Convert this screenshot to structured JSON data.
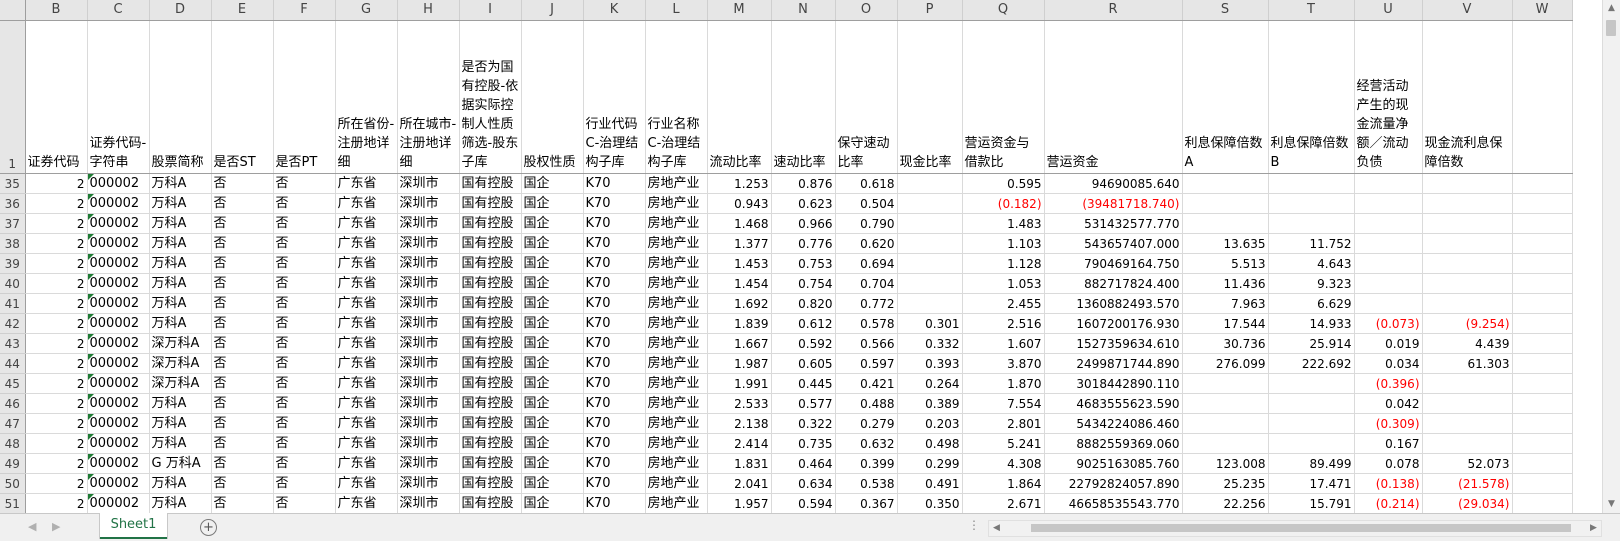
{
  "app": "Microsoft Excel",
  "columns": [
    "B",
    "C",
    "D",
    "E",
    "F",
    "G",
    "H",
    "I",
    "J",
    "K",
    "L",
    "M",
    "N",
    "O",
    "P",
    "Q",
    "R",
    "S",
    "T",
    "U",
    "V",
    "W"
  ],
  "header_row_number": "1",
  "headers": [
    "证券代码",
    "证券代码-字符串",
    "股票简称",
    "是否ST",
    "是否PT",
    "所在省份-注册地详细",
    "所在城市-注册地详细",
    "是否为国有控股-依据实际控制人性质筛选-股东子库",
    "股权性质",
    "行业代码C-治理结构子库",
    "行业名称C-治理结构子库",
    "流动比率",
    "速动比率",
    "保守速动比率",
    "现金比率",
    "营运资金与借款比",
    "营运资金",
    "利息保障倍数A",
    "利息保障倍数B",
    "经营活动产生的现金流量净额／流动负债",
    "现金流利息保障倍数",
    ""
  ],
  "rows": [
    {
      "n": "35",
      "v": [
        "2",
        "000002",
        "万科A",
        "否",
        "否",
        "广东省",
        "深圳市",
        "国有控股",
        "国企",
        "K70",
        "房地产业",
        "1.253",
        "0.876",
        "0.618",
        "",
        "0.595",
        "94690085.640",
        "",
        "",
        "",
        "",
        ""
      ]
    },
    {
      "n": "36",
      "v": [
        "2",
        "000002",
        "万科A",
        "否",
        "否",
        "广东省",
        "深圳市",
        "国有控股",
        "国企",
        "K70",
        "房地产业",
        "0.943",
        "0.623",
        "0.504",
        "",
        "(0.182)",
        "(39481718.740)",
        "",
        "",
        "",
        "",
        ""
      ]
    },
    {
      "n": "37",
      "v": [
        "2",
        "000002",
        "万科A",
        "否",
        "否",
        "广东省",
        "深圳市",
        "国有控股",
        "国企",
        "K70",
        "房地产业",
        "1.468",
        "0.966",
        "0.790",
        "",
        "1.483",
        "531432577.770",
        "",
        "",
        "",
        "",
        ""
      ]
    },
    {
      "n": "38",
      "v": [
        "2",
        "000002",
        "万科A",
        "否",
        "否",
        "广东省",
        "深圳市",
        "国有控股",
        "国企",
        "K70",
        "房地产业",
        "1.377",
        "0.776",
        "0.620",
        "",
        "1.103",
        "543657407.000",
        "13.635",
        "11.752",
        "",
        "",
        ""
      ]
    },
    {
      "n": "39",
      "v": [
        "2",
        "000002",
        "万科A",
        "否",
        "否",
        "广东省",
        "深圳市",
        "国有控股",
        "国企",
        "K70",
        "房地产业",
        "1.453",
        "0.753",
        "0.694",
        "",
        "1.128",
        "790469164.750",
        "5.513",
        "4.643",
        "",
        "",
        ""
      ]
    },
    {
      "n": "40",
      "v": [
        "2",
        "000002",
        "万科A",
        "否",
        "否",
        "广东省",
        "深圳市",
        "国有控股",
        "国企",
        "K70",
        "房地产业",
        "1.454",
        "0.754",
        "0.704",
        "",
        "1.053",
        "882717824.400",
        "11.436",
        "9.323",
        "",
        "",
        ""
      ]
    },
    {
      "n": "41",
      "v": [
        "2",
        "000002",
        "万科A",
        "否",
        "否",
        "广东省",
        "深圳市",
        "国有控股",
        "国企",
        "K70",
        "房地产业",
        "1.692",
        "0.820",
        "0.772",
        "",
        "2.455",
        "1360882493.570",
        "7.963",
        "6.629",
        "",
        "",
        ""
      ]
    },
    {
      "n": "42",
      "v": [
        "2",
        "000002",
        "万科A",
        "否",
        "否",
        "广东省",
        "深圳市",
        "国有控股",
        "国企",
        "K70",
        "房地产业",
        "1.839",
        "0.612",
        "0.578",
        "0.301",
        "2.516",
        "1607200176.930",
        "17.544",
        "14.933",
        "(0.073)",
        "(9.254)",
        ""
      ]
    },
    {
      "n": "43",
      "v": [
        "2",
        "000002",
        "深万科A",
        "否",
        "否",
        "广东省",
        "深圳市",
        "国有控股",
        "国企",
        "K70",
        "房地产业",
        "1.667",
        "0.592",
        "0.566",
        "0.332",
        "1.607",
        "1527359634.610",
        "30.736",
        "25.914",
        "0.019",
        "4.439",
        ""
      ]
    },
    {
      "n": "44",
      "v": [
        "2",
        "000002",
        "深万科A",
        "否",
        "否",
        "广东省",
        "深圳市",
        "国有控股",
        "国企",
        "K70",
        "房地产业",
        "1.987",
        "0.605",
        "0.597",
        "0.393",
        "3.870",
        "2499871744.890",
        "276.099",
        "222.692",
        "0.034",
        "61.303",
        ""
      ]
    },
    {
      "n": "45",
      "v": [
        "2",
        "000002",
        "深万科A",
        "否",
        "否",
        "广东省",
        "深圳市",
        "国有控股",
        "国企",
        "K70",
        "房地产业",
        "1.991",
        "0.445",
        "0.421",
        "0.264",
        "1.870",
        "3018442890.110",
        "",
        "",
        "(0.396)",
        "",
        ""
      ]
    },
    {
      "n": "46",
      "v": [
        "2",
        "000002",
        "万科A",
        "否",
        "否",
        "广东省",
        "深圳市",
        "国有控股",
        "国企",
        "K70",
        "房地产业",
        "2.533",
        "0.577",
        "0.488",
        "0.389",
        "7.554",
        "4683555623.590",
        "",
        "",
        "0.042",
        "",
        ""
      ]
    },
    {
      "n": "47",
      "v": [
        "2",
        "000002",
        "万科A",
        "否",
        "否",
        "广东省",
        "深圳市",
        "国有控股",
        "国企",
        "K70",
        "房地产业",
        "2.138",
        "0.322",
        "0.279",
        "0.203",
        "2.801",
        "5434224086.460",
        "",
        "",
        "(0.309)",
        "",
        ""
      ]
    },
    {
      "n": "48",
      "v": [
        "2",
        "000002",
        "万科A",
        "否",
        "否",
        "广东省",
        "深圳市",
        "国有控股",
        "国企",
        "K70",
        "房地产业",
        "2.414",
        "0.735",
        "0.632",
        "0.498",
        "5.241",
        "8882559369.060",
        "",
        "",
        "0.167",
        "",
        ""
      ]
    },
    {
      "n": "49",
      "v": [
        "2",
        "000002",
        "G 万科A",
        "否",
        "否",
        "广东省",
        "深圳市",
        "国有控股",
        "国企",
        "K70",
        "房地产业",
        "1.831",
        "0.464",
        "0.399",
        "0.299",
        "4.308",
        "9025163085.760",
        "123.008",
        "89.499",
        "0.078",
        "52.073",
        ""
      ]
    },
    {
      "n": "50",
      "v": [
        "2",
        "000002",
        "万科A",
        "否",
        "否",
        "广东省",
        "深圳市",
        "国有控股",
        "国企",
        "K70",
        "房地产业",
        "2.041",
        "0.634",
        "0.538",
        "0.491",
        "1.864",
        "22792824057.890",
        "25.235",
        "17.471",
        "(0.138)",
        "(21.578)",
        ""
      ]
    },
    {
      "n": "51",
      "v": [
        "2",
        "000002",
        "万科A",
        "否",
        "否",
        "广东省",
        "深圳市",
        "国有控股",
        "国企",
        "K70",
        "房地产业",
        "1.957",
        "0.594",
        "0.367",
        "0.350",
        "2.671",
        "46658535543.770",
        "22.256",
        "15.791",
        "(0.214)",
        "(29.034)",
        ""
      ]
    }
  ],
  "sheet_tab": "Sheet1",
  "colors": {
    "negative": "#ff0000",
    "tab_accent": "#217346",
    "header_bg": "#e6e6e6"
  }
}
